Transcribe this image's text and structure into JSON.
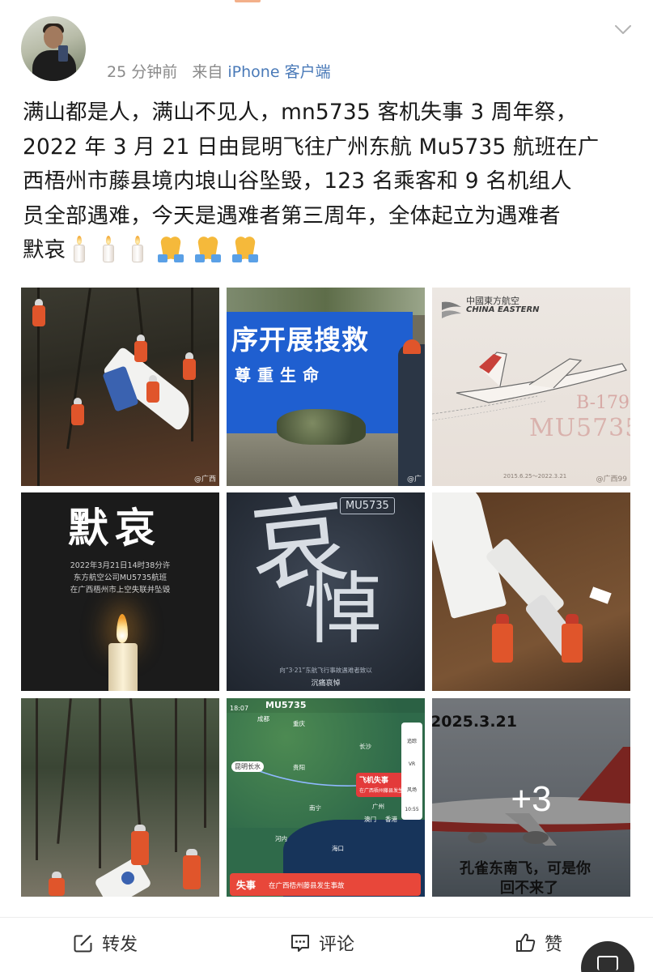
{
  "post": {
    "meta": {
      "time": "25 分钟前",
      "from": "来自",
      "source": "iPhone 客户端"
    },
    "text_lines": [
      "满山都是人，满山不见人，mn5735 客机失事 3 周年祭，",
      "2022 年 3 月 21 日由昆明飞往广州东航 Mu5735 航班在广",
      "西梧州市藤县境内埌山谷坠毁，123 名乘客和 9 名机组人",
      "员全部遇难，今天是遇难者第三周年，全体起立为遇难者",
      "默哀"
    ],
    "emojis": [
      "candle-emoji",
      "candle-emoji",
      "candle-emoji",
      "praying-hands-emoji",
      "praying-hands-emoji",
      "praying-hands-emoji"
    ]
  },
  "images": {
    "tile2": {
      "banner_line1": "序开展搜救",
      "banner_line2": "尊重生命"
    },
    "tile3": {
      "airline_cn": "中國東方航空",
      "airline_en": "CHINA EASTERN",
      "registration": "B-179",
      "flight": "MU5735",
      "dates": "2015.6.25～2022.3.21",
      "watermark": "@广西99"
    },
    "tile1": {
      "watermark": "@广西"
    },
    "tile2w": {
      "watermark": "@广"
    },
    "tile4": {
      "title": "默哀",
      "line1": "2022年3月21日14时38分许",
      "line2": "东方航空公司MU5735航班",
      "line3": "在广西梧州市上空失联并坠毁"
    },
    "tile5": {
      "tag": "MU5735",
      "calligraphy_1": "哀",
      "calligraphy_2": "悼",
      "caption_small": "向“3·21”东航飞行事故遇难者致以",
      "caption": "沉痛哀悼"
    },
    "tile8": {
      "time": "18:07",
      "flight": "MU5735",
      "origin": "昆明长水",
      "alert_title": "飞机失事",
      "alert_sub": "在广西梧州藤县发生事故",
      "cities": [
        "成都",
        "重庆",
        "贵阳",
        "长沙",
        "南宁",
        "广州",
        "澳门",
        "香港",
        "河内",
        "海口"
      ],
      "side": [
        "追踪",
        "VR",
        "风场",
        "10:55"
      ],
      "bottom_label": "失事",
      "bottom_text": "在广西梧州藤县发生事故"
    },
    "tile9": {
      "date": "2025.3.21",
      "caption_line1": "孔雀东南飞，可是你",
      "caption_line2": "回不来了",
      "more": "+3"
    }
  },
  "actions": {
    "repost": "转发",
    "comment": "评论",
    "like": "赞"
  },
  "colors": {
    "source_link": "#4a7ab8",
    "meta_gray": "#8a8a8a",
    "text": "#1a1a1a"
  }
}
